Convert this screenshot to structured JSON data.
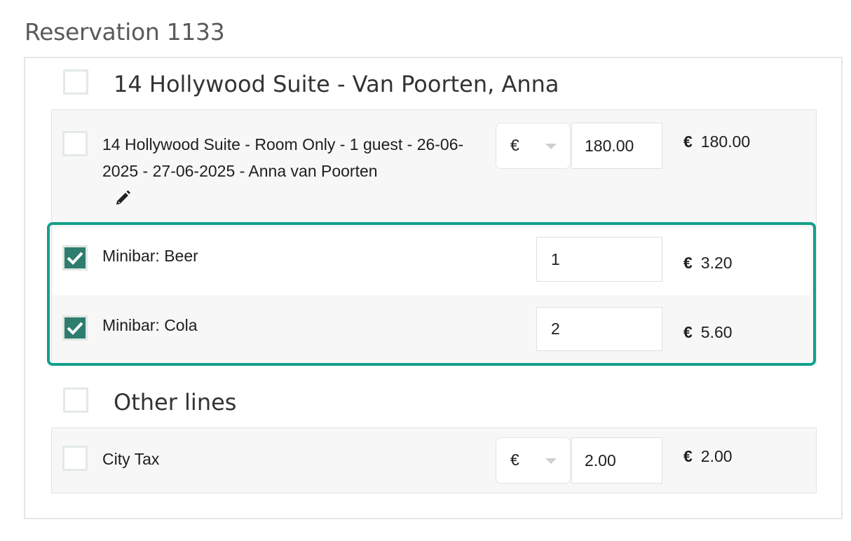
{
  "page": {
    "title": "Reservation 1133"
  },
  "room_group": {
    "title": "14 Hollywood Suite - Van Poorten, Anna",
    "checked": false,
    "lines": [
      {
        "description_line1": "14 Hollywood Suite - Room Only - 1 guest - 26-06-",
        "description_line2": "2025 - 27-06-2025 - Anna van Poorten",
        "currency_select": "€",
        "amount": "180.00",
        "price_currency": "€",
        "price_value": "180.00",
        "checked": false,
        "edit_icon": "pencil-icon"
      },
      {
        "description": "Minibar: Beer",
        "quantity": "1",
        "price_currency": "€",
        "price_value": "3.20",
        "checked": true
      },
      {
        "description": "Minibar: Cola",
        "quantity": "2",
        "price_currency": "€",
        "price_value": "5.60",
        "checked": true
      }
    ]
  },
  "other_group": {
    "title": "Other lines",
    "checked": false,
    "lines": [
      {
        "description": "City Tax",
        "currency_select": "€",
        "amount": "2.00",
        "price_currency": "€",
        "price_value": "2.00",
        "checked": false
      }
    ]
  },
  "colors": {
    "checkbox_checked": "#2e7d6e",
    "highlight_border": "#12a08c",
    "panel_background": "#f7f7f7"
  }
}
